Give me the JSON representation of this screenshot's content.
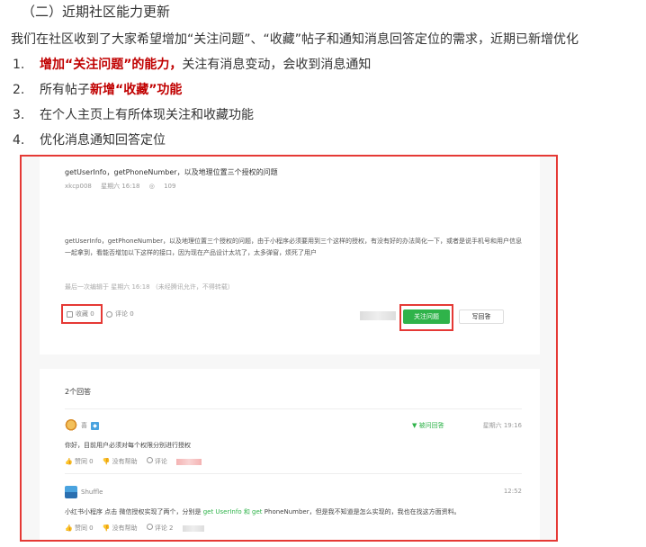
{
  "doc": {
    "heading": "（二）近期社区能力更新",
    "intro": "我们在社区收到了大家希望增加“关注问题”、“收藏”帖子和通知消息回答定位的需求，近期已新增优化",
    "list": [
      {
        "num": "1.",
        "strong": "增加“关注问题”的能力，",
        "rest": "关注有消息变动，会收到消息通知"
      },
      {
        "num": "2.",
        "pre": "所有帖子",
        "strong": "新增“收藏”功能"
      },
      {
        "num": "3.",
        "text": "在个人主页上有所体现关注和收藏功能"
      },
      {
        "num": "4.",
        "text": "优化消息通知回答定位"
      }
    ]
  },
  "shot": {
    "question": {
      "title": "getUserInfo，getPhoneNumber，以及地理位置三个授权的问题",
      "author": "xkcp008",
      "time": "星期六 16:18",
      "views": "109",
      "body": "getUserInfo，getPhoneNumber，以及地理位置三个授权的问题，由于小程序必须要用到三个这样的授权，有没有好的办法简化一下，或者是说手机号和用户信息一起拿到，看能否增加以下这样的接口，因为现在产品设计太坑了，太多弹窗，烦死了用户",
      "last_edit": "最后一次编辑于  星期六 16:18  （未经腾讯允许，不得转载）",
      "fav": "收藏 0",
      "comment": "评论 0",
      "follow_btn": "关注问题",
      "write_btn": "写回答"
    },
    "answers": {
      "count": "2个回答",
      "items": [
        {
          "name": "喜",
          "accepted": "▼ 被问回答",
          "time": "星期六 19:16",
          "text": "你好，目前用户必须对每个权限分别进行授权",
          "like": "赞同 0",
          "unhelp": "没有帮助",
          "comment": "评论"
        },
        {
          "name": "Shuffle",
          "time": "12:52",
          "text_pre": "小红书小程序 点击 微信授权实现了两个，分别是 ",
          "text_hl": "get UserInfo 和  get",
          "text_post": " PhoneNumber，但是我不知道是怎么实现的，我也在找这方面资料。",
          "like": "赞同 0",
          "unhelp": "没有帮助",
          "comment": "评论 2"
        }
      ]
    }
  }
}
